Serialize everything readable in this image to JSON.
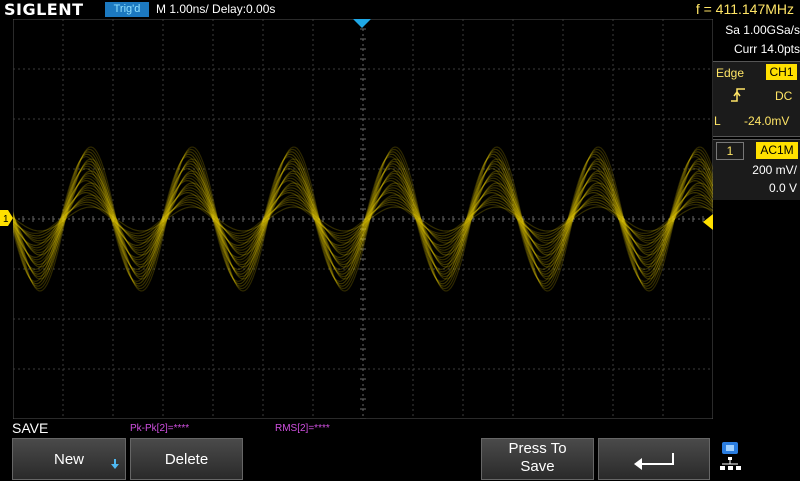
{
  "header": {
    "logo": "SIGLENT",
    "trigger_status": "Trig'd",
    "timebase": "M 1.00ns/  Delay:0.00s",
    "frequency": "f = 411.147MHz"
  },
  "acquisition": {
    "sample_rate": "Sa 1.00GSa/s",
    "memory": "Curr 14.0pts"
  },
  "trigger": {
    "type": "Edge",
    "source": "CH1",
    "coupling": "DC",
    "level_label": "L",
    "level": "-24.0mV"
  },
  "channel": {
    "number": "1",
    "coupling": "AC1M",
    "scale": "200 mV/",
    "offset": "0.0 V"
  },
  "markers": {
    "ch1": "1"
  },
  "bottom": {
    "menu_title": "SAVE",
    "measure_pkpk": "Pk-Pk[2]=****",
    "measure_rms": "RMS[2]=****",
    "softkeys": {
      "new": "New",
      "delete": "Delete",
      "press_to_save": "Press To Save"
    }
  },
  "colors": {
    "ch1": "#ffe000",
    "trigger_marker": "#1fa8e6",
    "measure": "#d050e0",
    "grid": "#3c3c3c"
  },
  "icons": {
    "new_arrow": "arrow-down-icon",
    "back": "return-arrow-icon",
    "network": "network-icon",
    "edge": "rising-edge-icon"
  }
}
